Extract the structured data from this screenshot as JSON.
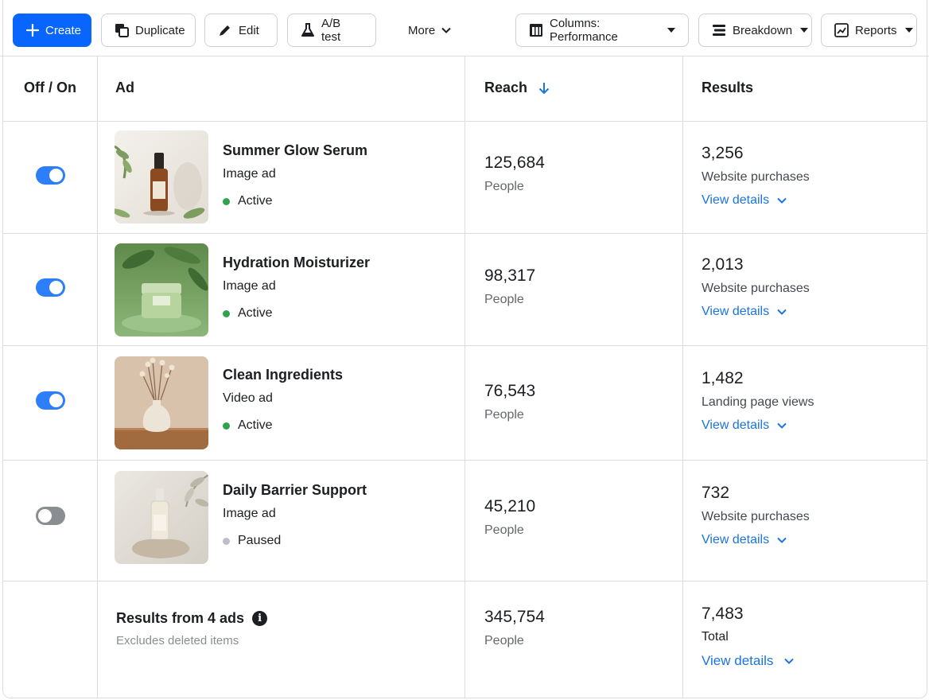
{
  "toolbar": {
    "create": "Create",
    "duplicate": "Duplicate",
    "edit": "Edit",
    "ab_test": "A/B test",
    "more": "More",
    "columns": "Columns: Performance",
    "breakdown": "Breakdown",
    "reports": "Reports"
  },
  "table": {
    "headers": {
      "toggle": "Off / On",
      "ad": "Ad",
      "reach": "Reach",
      "results": "Results"
    },
    "rows": [
      {
        "name": "Summer Glow Serum",
        "type": "Image ad",
        "status": "Active",
        "enabled": true,
        "reach": "125,684",
        "reach_unit": "People",
        "results": "3,256",
        "result_type": "Website purchases",
        "details": "View details"
      },
      {
        "name": "Hydration Moisturizer",
        "type": "Image ad",
        "status": "Active",
        "enabled": true,
        "reach": "98,317",
        "reach_unit": "People",
        "results": "2,013",
        "result_type": "Website purchases",
        "details": "View details"
      },
      {
        "name": "Clean Ingredients",
        "type": "Video ad",
        "status": "Active",
        "enabled": true,
        "reach": "76,543",
        "reach_unit": "People",
        "results": "1,482",
        "result_type": "Landing page views",
        "details": "View details"
      },
      {
        "name": "Daily Barrier Support",
        "type": "Image ad",
        "status": "Paused",
        "enabled": false,
        "reach": "45,210",
        "reach_unit": "People",
        "results": "732",
        "result_type": "Website purchases",
        "details": "View details"
      }
    ],
    "summary": {
      "title": "Results from 4 ads",
      "subtitle": "Excludes deleted items",
      "reach": "345,754",
      "reach_unit": "People",
      "results": "7,483",
      "result_type": "Total",
      "details": "View details"
    }
  },
  "colors": {
    "accent": "#0866ff",
    "link": "#1b74e4",
    "active": "#31a24c",
    "paused": "#bcc0c4",
    "toggle_on": "#2d7ff9"
  }
}
